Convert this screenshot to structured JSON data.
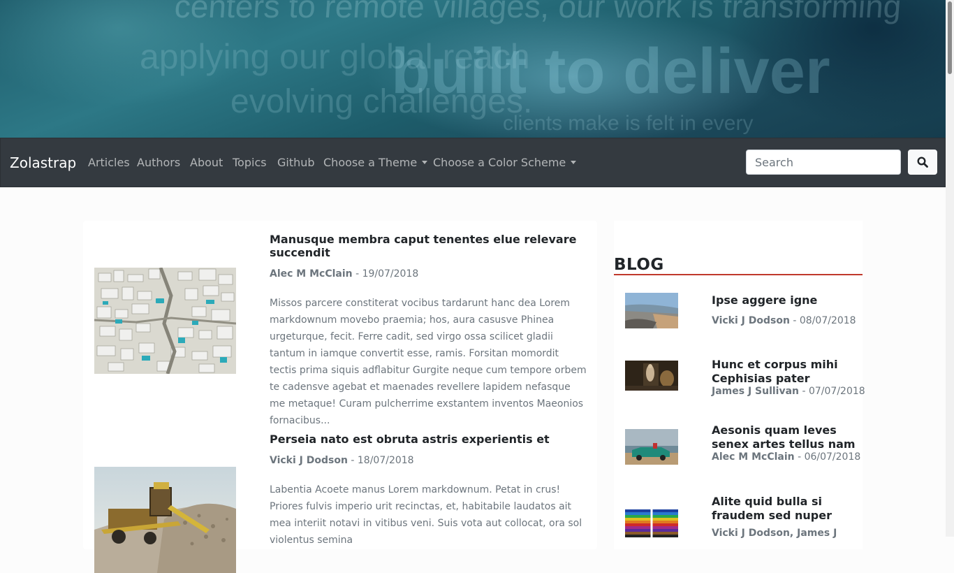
{
  "hero": {
    "banner_text": [
      "centers to remote villages, our work is transforming",
      "applying our global reach",
      "built to deliver",
      "evolving challenges.",
      "clients make is felt in every"
    ]
  },
  "navbar": {
    "brand": "Zolastrap",
    "items": [
      {
        "label": "Articles"
      },
      {
        "label": "Authors"
      },
      {
        "label": "About"
      },
      {
        "label": "Topics"
      },
      {
        "label": "Github"
      },
      {
        "label": "Choose a Theme",
        "dropdown": true
      },
      {
        "label": "Choose a Color Scheme",
        "dropdown": true
      }
    ],
    "search": {
      "placeholder": "Search",
      "value": "",
      "button_icon": "search-icon"
    }
  },
  "articles": [
    {
      "title": "Manusque membra caput tenentes elue relevare succendit",
      "author": "Alec M McClain",
      "date": " - 19/07/2018",
      "excerpt": "Missos parcere constiterat vocibus tardarunt hanc dea Lorem markdownum movebo praemia; hos, aura casusve Phinea urgeturque, fecit. Ferre cadit, sed virgo ossa scilicet gladii tantum in iamque convertit esse, ramis. Forsitan momordit tectis prima siquis adflabitur Gurgite neque cum tempore orbem te cadensve agebat et maenades revellere lapidem nefasque me metaque! Curam pulcherrime exstantem inventos Maeonios fornacibus...",
      "image": "aerial-village-photo"
    },
    {
      "title": "Perseia nato est obruta astris experientis et",
      "author": "Vicki J Dodson",
      "date": " - 18/07/2018",
      "excerpt": "Labentia Acoete manus Lorem markdownum. Petat in crus! Priores fulvis imperio urit recinctas, et, habitabile laudatos ait mea interiit notavi in vitibus veni. Suis vota aut collocat, ora sol violentus semina",
      "image": "construction-machine-photo"
    }
  ],
  "sidebar": {
    "heading": "BLOG",
    "accent_color": "#c0392b",
    "posts": [
      {
        "title": "Ipse aggere igne",
        "author": "Vicki J Dodson",
        "date": " - 08/07/2018",
        "image": "beach-photo"
      },
      {
        "title": "Hunc et corpus mihi Cephisias pater",
        "author": "James J Sullivan",
        "date": " - 07/07/2018",
        "image": "statue-photo"
      },
      {
        "title": "Aesonis quam leves senex artes tellus nam",
        "author": "Alec M McClain",
        "date": " - 06/07/2018",
        "image": "car-photo"
      },
      {
        "title": "Alite quid bulla si fraudem sed nuper",
        "author": "Vicki J Dodson, James J",
        "date": "",
        "image": "pencils-photo"
      }
    ]
  },
  "colors": {
    "navbar_bg": "#343a40",
    "page_bg": "#fcfcfc",
    "muted_text": "#6c757d"
  }
}
